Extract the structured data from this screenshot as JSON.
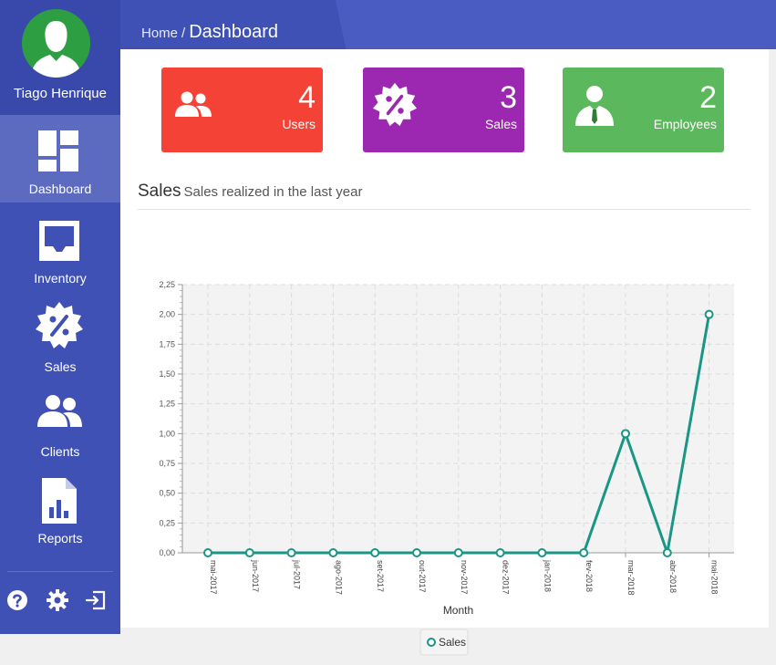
{
  "user": {
    "name": "Tiago Henrique"
  },
  "header": {
    "home": "Home",
    "separator": "/",
    "current": "Dashboard"
  },
  "nav": {
    "items": [
      {
        "label": "Dashboard",
        "icon": "dashboard-icon",
        "active": true
      },
      {
        "label": "Inventory",
        "icon": "inventory-icon",
        "active": false
      },
      {
        "label": "Sales",
        "icon": "sales-icon",
        "active": false
      },
      {
        "label": "Clients",
        "icon": "clients-icon",
        "active": false
      },
      {
        "label": "Reports",
        "icon": "reports-icon",
        "active": false
      }
    ],
    "bottom_icons": [
      "help-icon",
      "settings-icon",
      "logout-icon"
    ]
  },
  "cards": [
    {
      "value": "4",
      "label": "Users",
      "color": "#f44336",
      "icon": "users-icon"
    },
    {
      "value": "3",
      "label": "Sales",
      "color": "#9c27b0",
      "icon": "sales-badge-icon"
    },
    {
      "value": "2",
      "label": "Employees",
      "color": "#5cb85c",
      "icon": "employee-icon"
    }
  ],
  "section": {
    "title": "Sales",
    "subtitle": "Sales realized in the last year"
  },
  "colors": {
    "sidebar": "#3f51b5",
    "series": "#1a9685"
  },
  "chart_data": {
    "type": "line",
    "title": "",
    "xlabel": "Month",
    "ylabel": "",
    "categories": [
      "mai-2017",
      "jun-2017",
      "jul-2017",
      "ago-2017",
      "set-2017",
      "out-2017",
      "nov-2017",
      "dez-2017",
      "jan-2018",
      "fev-2018",
      "mar-2018",
      "abr-2018",
      "mai-2018"
    ],
    "series": [
      {
        "name": "Sales",
        "values": [
          0,
          0,
          0,
          0,
          0,
          0,
          0,
          0,
          0,
          0,
          1,
          0,
          2
        ]
      }
    ],
    "ylim": [
      0,
      2.25
    ],
    "yticks": [
      "0,00",
      "0,25",
      "0,50",
      "0,75",
      "1,00",
      "1,25",
      "1,50",
      "1,75",
      "2,00",
      "2,25"
    ],
    "grid": true,
    "legend": "bottom"
  }
}
